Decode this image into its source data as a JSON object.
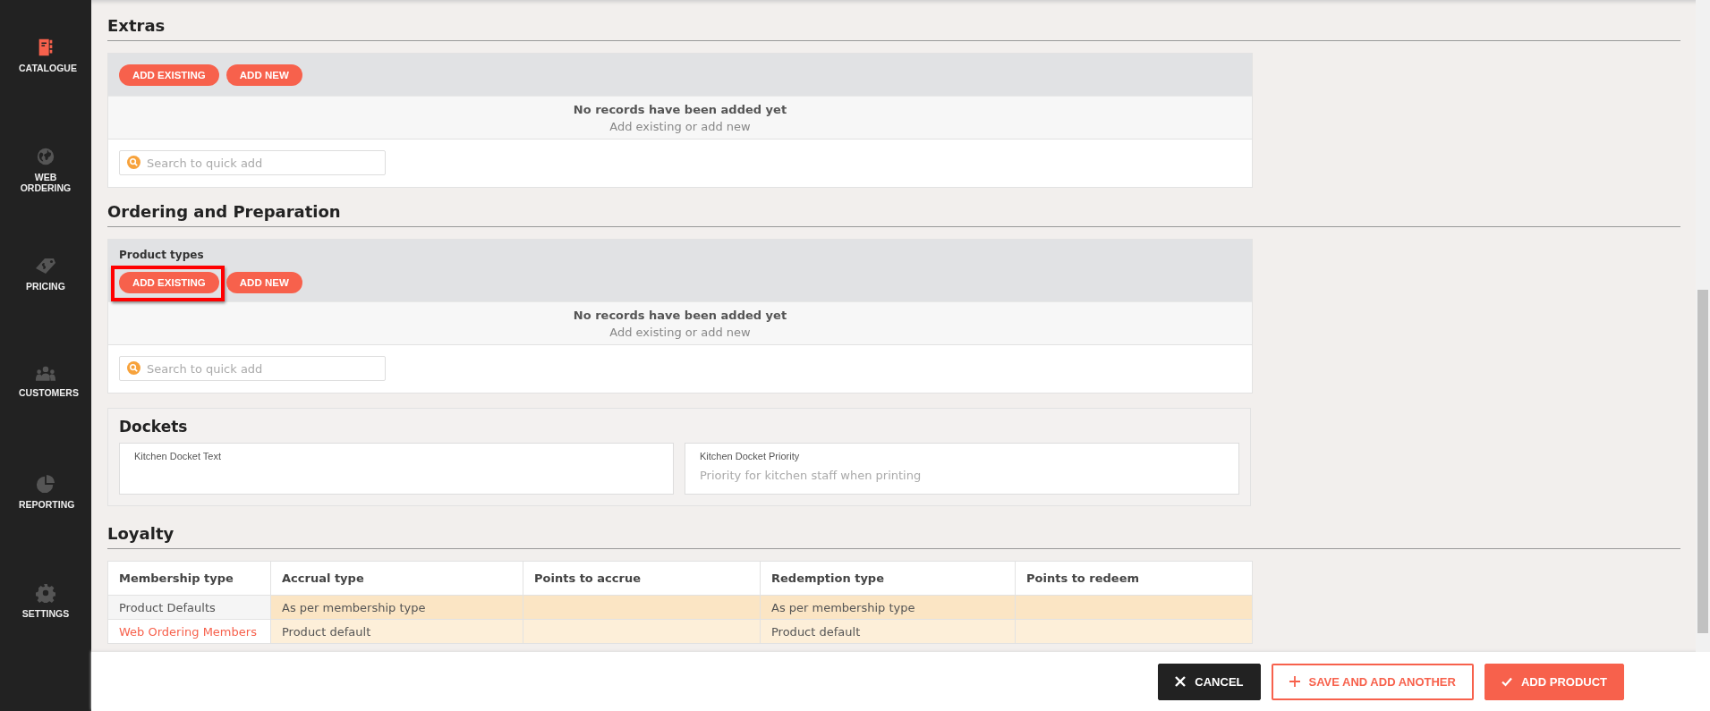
{
  "sidebar": {
    "items": [
      {
        "kind": "catalogue",
        "label": "CATALOGUE",
        "selected": true
      },
      {
        "kind": "globe",
        "label": "WEB ORDERING",
        "selected": false
      },
      {
        "kind": "tag",
        "label": "PRICING",
        "selected": false
      },
      {
        "kind": "people",
        "label": "CUSTOMERS",
        "selected": false
      },
      {
        "kind": "pie",
        "label": "REPORTING",
        "selected": false
      },
      {
        "kind": "gear",
        "label": "SETTINGS",
        "selected": false
      }
    ]
  },
  "sections": [
    {
      "kind": "list",
      "title": "Extras",
      "cards": [
        {
          "kind": "records",
          "buttons": [
            {
              "label": "ADD EXISTING",
              "highlighted": false
            },
            {
              "label": "ADD NEW",
              "highlighted": false
            }
          ],
          "empty_title": "No records have been added yet",
          "empty_hint": "Add existing or add new",
          "search": {
            "placeholder": "Search to quick add"
          }
        }
      ]
    },
    {
      "kind": "list",
      "title": "Ordering and Preparation",
      "cards": [
        {
          "kind": "records",
          "label": "Product types",
          "buttons": [
            {
              "label": "ADD EXISTING",
              "highlighted": true
            },
            {
              "label": "ADD NEW",
              "highlighted": false
            }
          ],
          "empty_title": "No records have been added yet",
          "empty_hint": "Add existing or add new",
          "search": {
            "placeholder": "Search to quick add"
          }
        },
        {
          "kind": "fields",
          "title": "Dockets",
          "fields": [
            {
              "label": "Kitchen Docket Text"
            },
            {
              "label": "Kitchen Docket Priority",
              "placeholder": "Priority for kitchen staff when printing"
            }
          ]
        }
      ]
    },
    {
      "kind": "table",
      "title": "Loyalty",
      "table": {
        "columns": [
          "Membership type",
          "Accrual type",
          "Points to accrue",
          "Redemption type",
          "Points to redeem"
        ],
        "rows": [
          {
            "kind": "defaults",
            "cells": [
              "Product Defaults",
              "As per membership type",
              "",
              "As per membership type",
              ""
            ]
          },
          {
            "kind": "membership",
            "cells": [
              "Web Ordering Members",
              "Product default",
              "",
              "Product default",
              ""
            ]
          }
        ]
      }
    }
  ],
  "footer": {
    "buttons": [
      {
        "kind": "cancel",
        "label": "CANCEL"
      },
      {
        "kind": "save_another",
        "label": "SAVE AND ADD ANOTHER"
      },
      {
        "kind": "add",
        "label": "ADD PRODUCT"
      }
    ]
  }
}
